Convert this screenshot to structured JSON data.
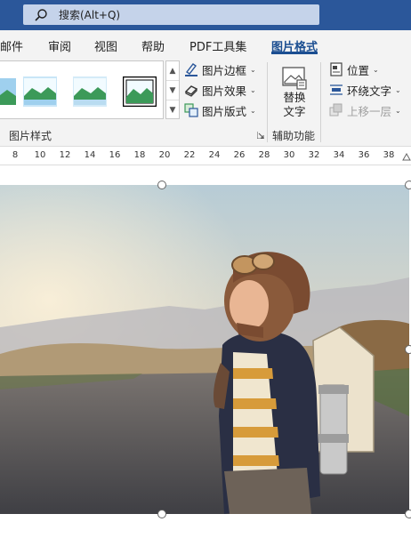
{
  "search": {
    "placeholder": "搜索(Alt+Q)"
  },
  "tabs": [
    {
      "label": "邮件"
    },
    {
      "label": "审阅"
    },
    {
      "label": "视图"
    },
    {
      "label": "帮助"
    },
    {
      "label": "PDF工具集"
    },
    {
      "label": "图片格式",
      "active": true
    }
  ],
  "ribbon": {
    "styles_group_label": "图片样式",
    "border_label": "图片边框",
    "effects_label": "图片效果",
    "layout_label": "图片版式",
    "alt_text_line1": "替换",
    "alt_text_line2": "文字",
    "accessibility_group_label": "辅助功能",
    "position_label": "位置",
    "wrap_text_label": "环绕文字",
    "bring_forward_label": "上移一层"
  },
  "ruler": {
    "numbers": [
      "8",
      "10",
      "12",
      "14",
      "16",
      "18",
      "20",
      "22",
      "24",
      "26",
      "28",
      "30",
      "32",
      "34",
      "36",
      "38"
    ]
  },
  "colors": {
    "titlebar": "#2b579a",
    "accent": "#1b4e91",
    "ribbon_bg": "#f3f3f3"
  },
  "image": {
    "subject": "child with aviator hat and cardboard rocket backpack on a road"
  }
}
